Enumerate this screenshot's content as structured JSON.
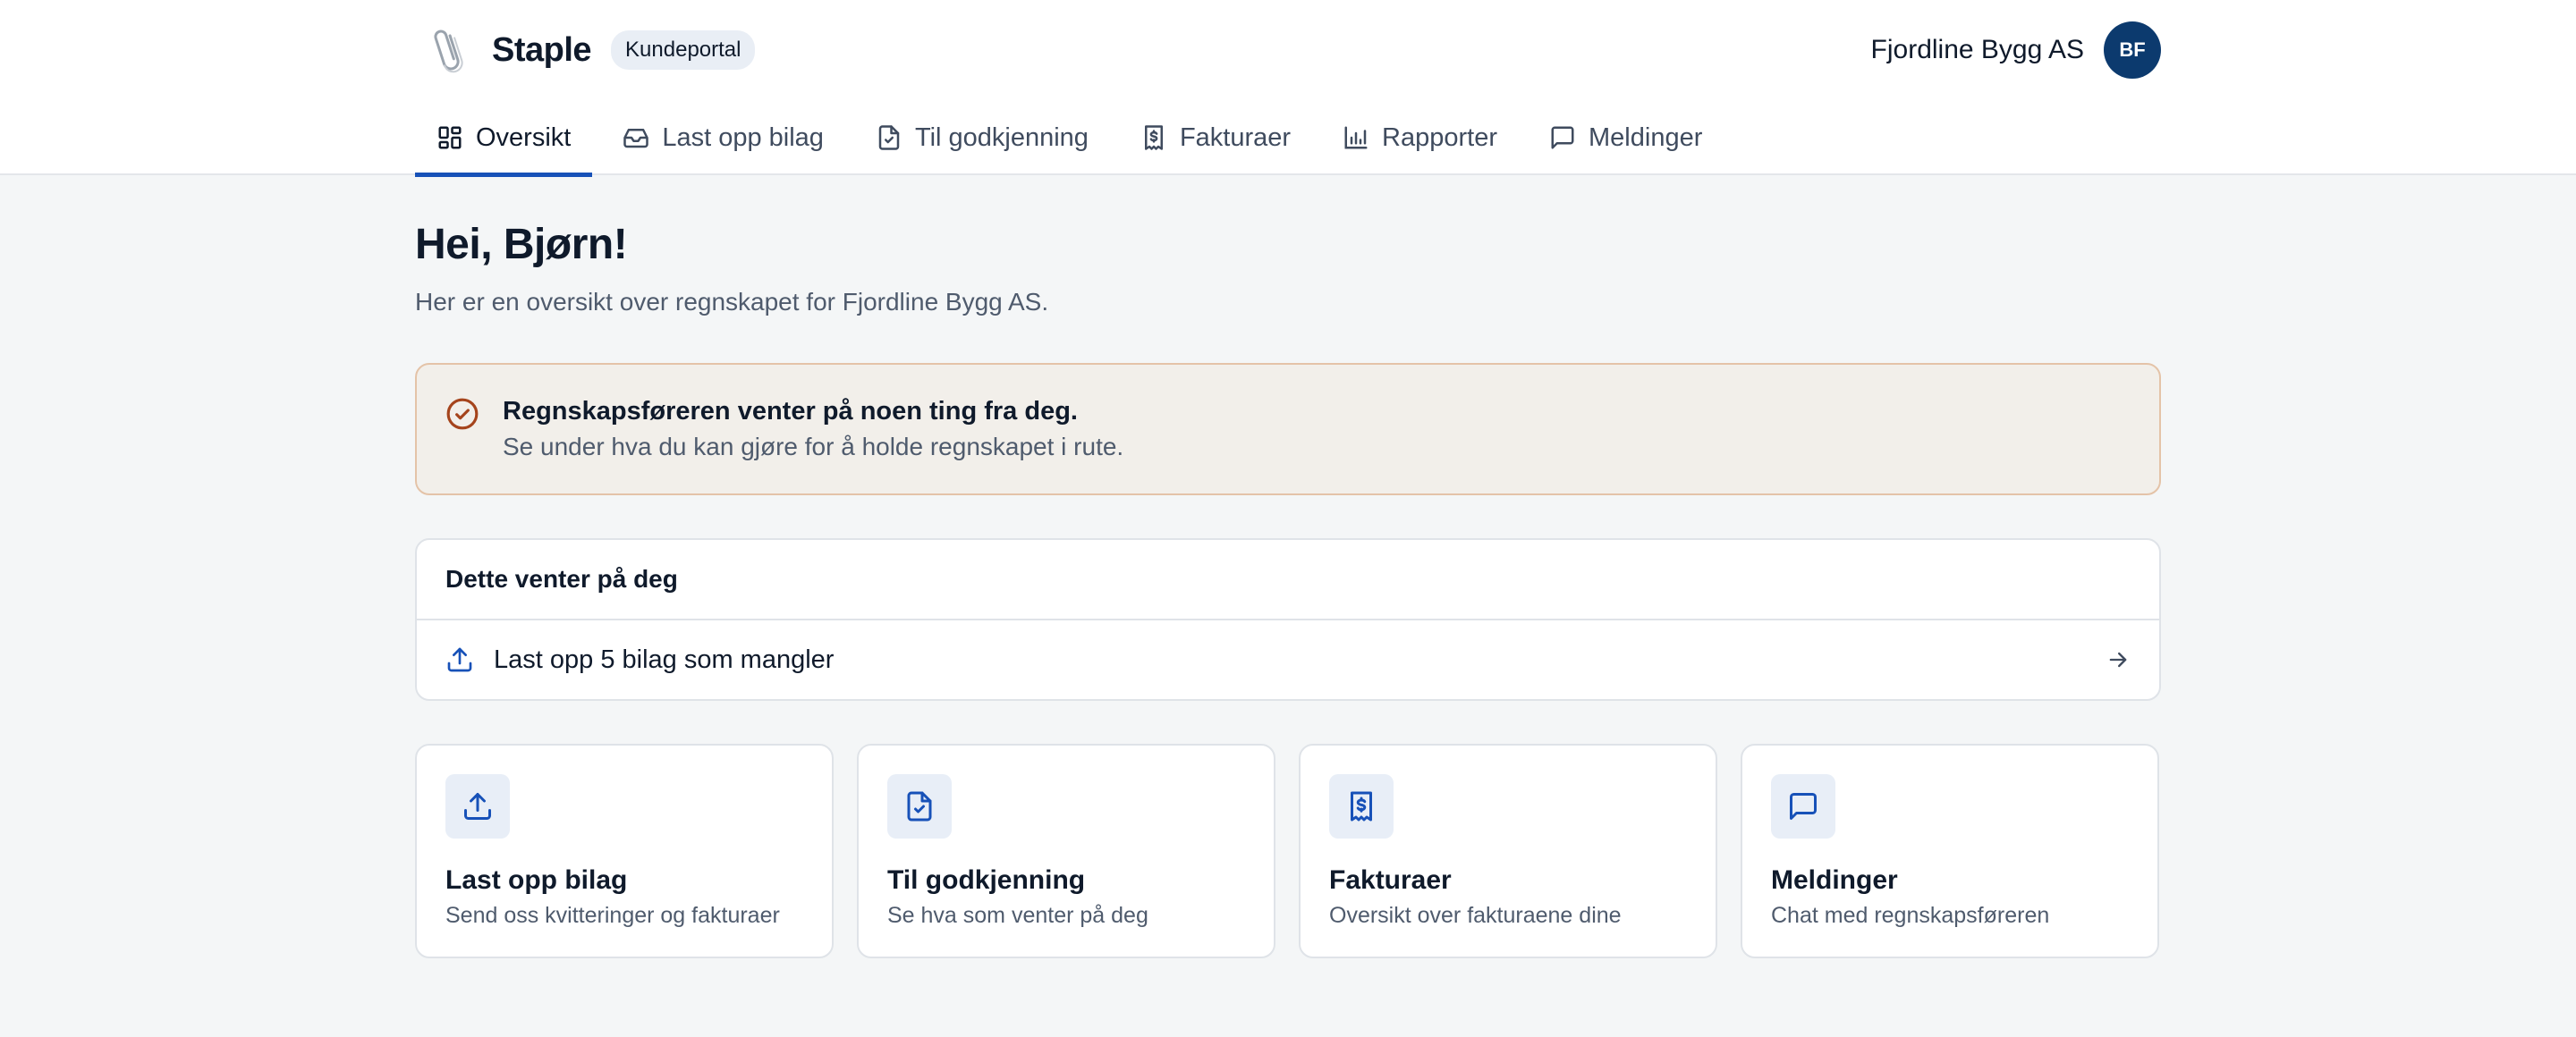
{
  "brand": {
    "name": "Staple",
    "badge": "Kundeportal",
    "logo_icon": "paperclip-icon"
  },
  "account": {
    "company": "Fjordline Bygg AS",
    "avatar_initials": "BF"
  },
  "nav": {
    "tabs": [
      {
        "label": "Oversikt",
        "icon": "dashboard-icon",
        "active": true
      },
      {
        "label": "Last opp bilag",
        "icon": "inbox-icon",
        "active": false
      },
      {
        "label": "Til godkjenning",
        "icon": "document-check-icon",
        "active": false
      },
      {
        "label": "Fakturaer",
        "icon": "invoice-icon",
        "active": false
      },
      {
        "label": "Rapporter",
        "icon": "bar-chart-icon",
        "active": false
      },
      {
        "label": "Meldinger",
        "icon": "message-icon",
        "active": false
      }
    ]
  },
  "main": {
    "greeting": "Hei, Bjørn!",
    "subtitle": "Her er en oversikt over regnskapet for Fjordline Bygg AS."
  },
  "alert": {
    "title": "Regnskapsføreren venter på noen ting fra deg.",
    "text": "Se under hva du kan gjøre for å holde regnskapet i rute."
  },
  "pending": {
    "heading": "Dette venter på deg",
    "items": [
      {
        "label": "Last opp 5 bilag som mangler",
        "icon": "upload-icon"
      }
    ]
  },
  "cards": [
    {
      "title": "Last opp bilag",
      "description": "Send oss kvitteringer og fakturaer",
      "icon": "upload-icon"
    },
    {
      "title": "Til godkjenning",
      "description": "Se hva som venter på deg",
      "icon": "document-check-icon"
    },
    {
      "title": "Fakturaer",
      "description": "Oversikt over fakturaene dine",
      "icon": "invoice-icon"
    },
    {
      "title": "Meldinger",
      "description": "Chat med regnskapsføreren",
      "icon": "message-icon"
    }
  ],
  "colors": {
    "accent": "#1751b8",
    "avatar_bg": "#0c3a6e",
    "alert_border": "#e4c3a8",
    "alert_bg": "#f2efea",
    "alert_icon": "#a5441c",
    "page_bg": "#f4f6f7"
  }
}
